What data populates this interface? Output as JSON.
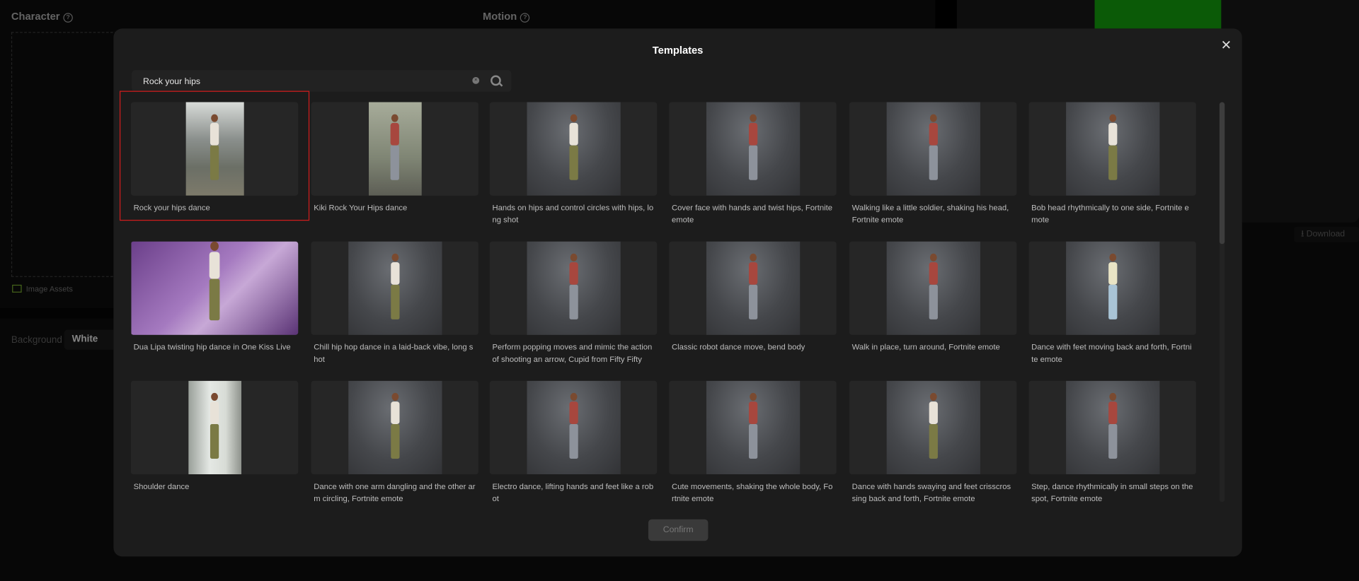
{
  "background_page": {
    "character_label": "Character",
    "motion_label": "Motion",
    "image_assets_label": "Image Assets",
    "background_label": "Background",
    "background_value": "White",
    "download_label": "Download",
    "accent_green": "#128a0c"
  },
  "modal": {
    "title": "Templates",
    "search_value": "Rock your hips",
    "confirm_label": "Confirm",
    "selected_index": 0,
    "selection_color": "#d21d1d",
    "templates": [
      {
        "caption": "Rock your hips dance",
        "thumb": "photo-hallway"
      },
      {
        "caption": "Kiki Rock Your Hips dance",
        "thumb": "photo-room"
      },
      {
        "caption": "Hands on hips and control circles with hips, long shot",
        "thumb": "female-3d"
      },
      {
        "caption": "Cover face with hands and twist hips, Fortnite emote",
        "thumb": "male-3d"
      },
      {
        "caption": "Walking like a little soldier, shaking his head, Fortnite emote",
        "thumb": "male-3d"
      },
      {
        "caption": "Bob head rhythmically to one side, Fortnite emote",
        "thumb": "female-3d"
      },
      {
        "caption": "Dua Lipa twisting hip dance in One Kiss Live",
        "thumb": "photo-stage"
      },
      {
        "caption": "Chill hip hop dance in a laid-back vibe, long shot",
        "thumb": "female-3d"
      },
      {
        "caption": "Perform popping moves and mimic the action of shooting an arrow, Cupid from Fifty Fifty",
        "thumb": "male-3d"
      },
      {
        "caption": "Classic robot dance move, bend body",
        "thumb": "male-3d"
      },
      {
        "caption": "Walk in place, turn around, Fortnite emote",
        "thumb": "male-3d"
      },
      {
        "caption": "Dance with feet moving back and forth, Fortnite emote",
        "thumb": "female-3d-jeans"
      },
      {
        "caption": "Shoulder dance",
        "thumb": "photo-door"
      },
      {
        "caption": "Dance with one arm dangling and the other arm circling, Fortnite emote",
        "thumb": "female-3d"
      },
      {
        "caption": "Electro dance, lifting hands and feet like a robot",
        "thumb": "male-3d"
      },
      {
        "caption": "Cute movements, shaking the whole body, Fortnite emote",
        "thumb": "male-3d"
      },
      {
        "caption": "Dance with hands swaying and feet crisscrossing back and forth, Fortnite emote",
        "thumb": "female-3d"
      },
      {
        "caption": "Step, dance rhythmically in small steps on the spot, Fortnite emote",
        "thumb": "male-3d"
      }
    ]
  }
}
